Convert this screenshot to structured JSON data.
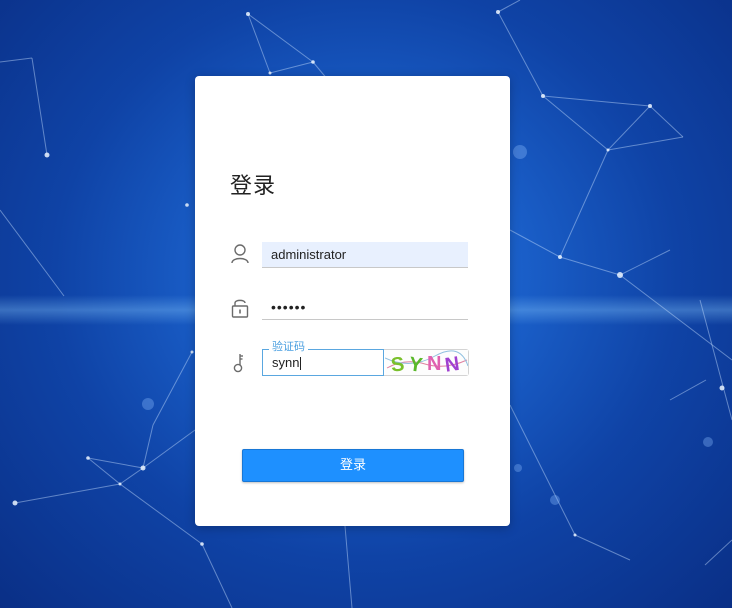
{
  "login": {
    "title": "登录",
    "username": {
      "value": "administrator",
      "icon": "user-icon"
    },
    "password": {
      "value": "••••••",
      "icon": "unlock-icon"
    },
    "captcha": {
      "label": "验证码",
      "value": "synn",
      "icon": "key-icon",
      "image_text": "SYNN"
    },
    "submit_label": "登录"
  },
  "colors": {
    "background": "#1a5fc9",
    "button": "#1e90ff",
    "captcha_label": "#4a9fe0"
  }
}
